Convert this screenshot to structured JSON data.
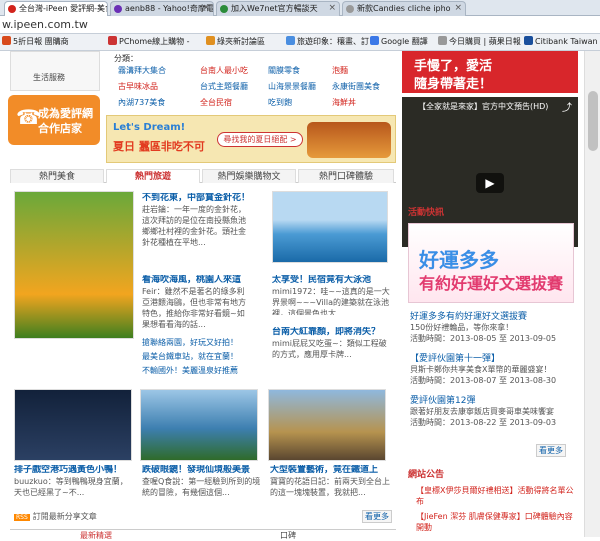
{
  "tabs": [
    {
      "title": "全台灣-iPeen 愛評網-美食",
      "color": "#d2231c",
      "active": true
    },
    {
      "title": "aenb88 - Yahoo!奇摩電",
      "color": "#6a2fb5",
      "active": false
    },
    {
      "title": "加入We7net官方暢談天",
      "color": "#2b8c3a",
      "active": false
    },
    {
      "title": "新款Candies cliche ipho",
      "color": "#999999",
      "active": false
    }
  ],
  "url": "w.ipeen.com.tw",
  "bookmarks": [
    {
      "label": "5折日報 團購商",
      "color": "#d84a1c"
    },
    {
      "label": "PChome線上購物 -",
      "color": "#c33"
    },
    {
      "label": "綠夾新討論區",
      "color": "#e09020"
    },
    {
      "label": "旅遊印象：穰畫、訂",
      "color": "#4a8ee0"
    },
    {
      "label": "Google 翻譯",
      "color": "#3b78e7"
    },
    {
      "label": "今日購買 | 蘋果日報",
      "color": "#999"
    },
    {
      "label": "Citibank Taiwan -",
      "color": "#1a4f9c"
    }
  ],
  "leftnav": {
    "item": "生活服務"
  },
  "cooperate": {
    "line1": "成為愛評網",
    "line2": "合作店家"
  },
  "categories": {
    "label": "分類：",
    "items": [
      "霧溝拜大集合",
      "台南人最小吃",
      "關膜零食",
      "泡麵",
      "古早味冰品",
      "台式主題餐廳",
      "山海景景餐廳",
      "永康街團美食",
      "內湖737美食",
      "全台民宿",
      "吃到飽",
      "海鮮丼"
    ]
  },
  "banner": {
    "line1": "Let's Dream!",
    "line2": "夏日 蠶區非吃不可",
    "button": "尋找我的夏日絕配 >"
  },
  "section_tabs": [
    "熱門美食",
    "熱門旅遊",
    "熱門娛樂購物文",
    "熱門口碑體驗"
  ],
  "articles": [
    {
      "title": "不到花東，中部賞金針花！",
      "body": "莊岩鑰：一年一度的金針花，這次拜訪的是位在南投縣魚池鄉鄉社村裡的金針花。頭社金針花種植在平地..."
    },
    {
      "title": "看海吹海風，桃園人來這",
      "body": "Feir：雖然不是著名的綠多利亞港餵海鷗，但也非常有地方特色，推給你非常好看鏡~如果想看看海的話..."
    },
    {
      "title": "太享受！民宿竟有大泳池",
      "body": "mimi1972：哇~~這真的是一大界景啊~~~Villa的建築就在泳池裡，這個景色也太..."
    },
    {
      "title": "台南大紅靠顏，即將消失？",
      "body": "mimi屁屁又吃蛋~：類似工程破的方式，應用厚卡牌..."
    }
  ],
  "related": [
    "搶聯絡兩園，好玩又好拍！",
    "最美台鐵車站，就在宜蘭！",
    "不輸國外！美麗溫泉好推薦"
  ],
  "bottom_items": [
    {
      "title": "排子戲空港巧遇黃色小鴨！",
      "body": "buuzkuo：等到鴨鴨現身宜蘭，天也已經黑了~不..."
    },
    {
      "title": "跌破眼鏡！發現仙境般美景",
      "body": "查喔Q食說：第一經驗到所到的境統的冒險，有幾個這個..."
    },
    {
      "title": "大型裝置藝術，竟在鐵道上",
      "body": "寶寶的花語日記：前兩天到全台上的這一塊塊裝置，我就把..."
    }
  ],
  "rss": "訂閱最新分享文章",
  "more": "看更多",
  "bottom_tabs": [
    "最新精選",
    "口碑"
  ],
  "right_top": {
    "line1": "手慢了，愛活",
    "line2": "隨身帶著走！"
  },
  "video_title": "【全家就是來家】官方中文預告(HD)",
  "activity_header": "活動快訊",
  "activity_banner": {
    "line1": "好運多多",
    "line2": "有約好運好文選拔賽"
  },
  "activities": [
    {
      "title": "好運多多有約好運好文選拔賽",
      "desc": "150份好禮輪品，等你來拿！",
      "date": "活動時間：2013-08-05 至 2013-09-05"
    },
    {
      "title": "【愛評伙園第十一彈】",
      "desc": "貝斯卡鄭你共享美食X單幣的華麗盛宴！",
      "date": "活動時間：2013-08-07 至 2013-08-30"
    },
    {
      "title": "愛評伙園第12彈",
      "desc": "跟著好朋友去康寧飯店買麥哥車美味饗宴",
      "date": "活動時間：2013-08-22 至 2013-09-03"
    }
  ],
  "announce_header": "網站公告",
  "announcements": [
    "【皇標X伊莎貝爾好禮相送】活動得將名單公布",
    "【JieFen 潔芬 肌膚保健專家】口碑體驗內容開動"
  ]
}
